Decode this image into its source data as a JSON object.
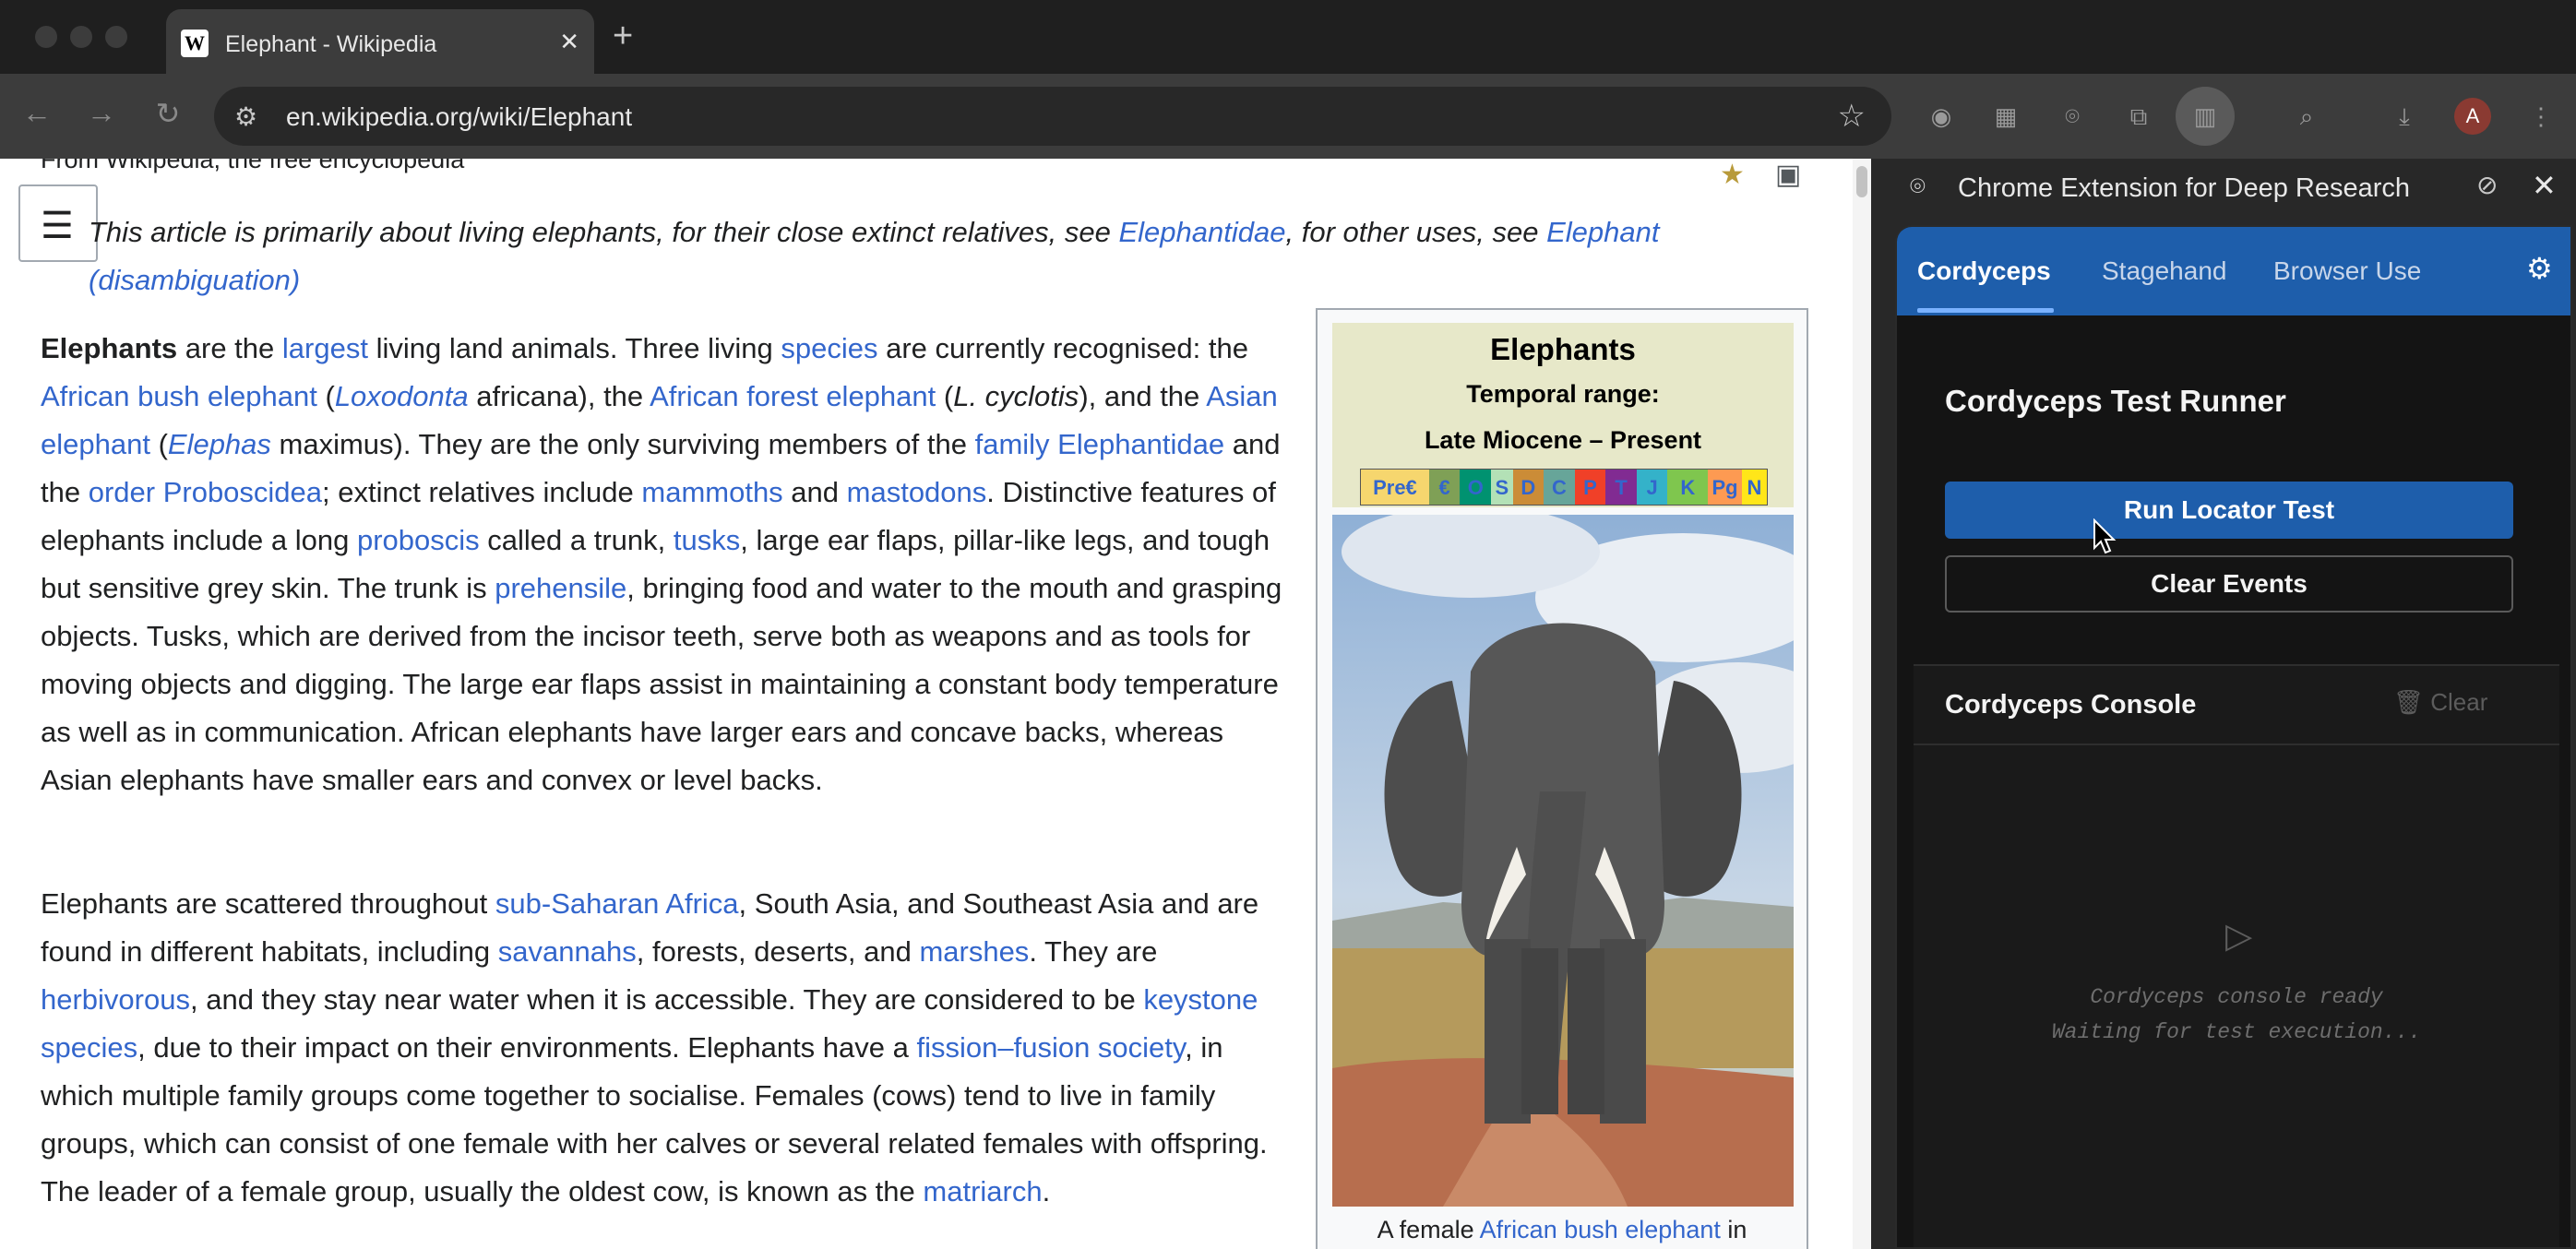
{
  "browser": {
    "tab": {
      "title": "Elephant - Wikipedia",
      "favicon": "W",
      "close": "✕"
    },
    "new_tab": "+",
    "url": "en.wikipedia.org/wiki/Elephant",
    "avatar_initial": "A",
    "nav_icons": [
      "back-icon",
      "forward-icon",
      "reload-icon"
    ]
  },
  "article": {
    "from_wiki": "From Wikipedia, the free encyclopedia",
    "hatnote": {
      "t1": "This article is primarily about living elephants, for their close extinct relatives, see ",
      "l1": "Elephantidae",
      "t2": ", for other uses, see ",
      "l2": "Elephant (disambiguation)"
    },
    "p1": {
      "s0": "Elephants",
      "s1": " are the ",
      "l_largest": "largest",
      "s2": " living land animals. Three living ",
      "l_species": "species",
      "s3": " are currently recognised: the ",
      "l_abe": "African bush elephant",
      "s4": " (",
      "i_loxodonta": "Loxodonta",
      "s5": " africana), the ",
      "l_afe": "African forest elephant",
      "s6": " (",
      "i_lc": "L. cyclotis",
      "s7": "), and the ",
      "l_asian": "Asian elephant",
      "s8": " (",
      "i_elephas": "Elephas",
      "s9": " maximus). They are the only surviving members of the ",
      "l_family": "family Elephantidae",
      "s10": " and the ",
      "l_order": "order Proboscidea",
      "s11": "; extinct relatives include ",
      "l_mammoths": "mammoths",
      "s12": " and ",
      "l_mastodons": "mastodons",
      "s13": ". Distinctive features of elephants include a long ",
      "l_proboscis": "proboscis",
      "s14": " called a trunk, ",
      "l_tusks": "tusks",
      "s15": ", large ear flaps, pillar-like legs, and tough but sensitive grey skin. The trunk is ",
      "l_prehensile": "prehensile",
      "s16": ", bringing food and water to the mouth and grasping objects. Tusks, which are derived from the incisor teeth, serve both as weapons and as tools for moving objects and digging. The large ear flaps assist in maintaining a constant body temperature as well as in communication. African elephants have larger ears and concave backs, whereas Asian elephants have smaller ears and convex or level backs."
    },
    "p2": {
      "s1": "Elephants are scattered throughout ",
      "l_ssa": "sub-Saharan Africa",
      "s2": ", South Asia, and Southeast Asia and are found in different habitats, including ",
      "l_savannahs": "savannahs",
      "s3": ", forests, deserts, and ",
      "l_marshes": "marshes",
      "s4": ". They are ",
      "l_herbivorous": "herbivorous",
      "s5": ", and they stay near water when it is accessible. They are considered to be ",
      "l_keystone": "keystone species",
      "s6": ", due to their impact on their environments. Elephants have a ",
      "l_fission": "fission–fusion society",
      "s7": ", in which multiple family groups come together to socialise. Females (cows) tend to live in family groups, which can consist of one female with her calves or several related females with offspring. The leader of a female group, usually the oldest cow, is known as the ",
      "l_matriarch": "matriarch",
      "s8": "."
    },
    "infobox": {
      "title": "Elephants",
      "range_label": "Temporal range:",
      "range_value": "Late Miocene – Present",
      "timeline": [
        "Pre€",
        "€",
        "O",
        "S",
        "D",
        "C",
        "P",
        "T",
        "J",
        "K",
        "Pg",
        "N"
      ],
      "timeline_colors": [
        "#f6d66e",
        "#7fa056",
        "#009270",
        "#b3e1b6",
        "#cb8c37",
        "#67a599",
        "#f04028",
        "#812b92",
        "#34b2c9",
        "#7fc64e",
        "#fd9a52",
        "#ffe619"
      ],
      "caption_text": "A female ",
      "caption_link": "African bush elephant",
      "caption_tail": " in"
    }
  },
  "side_panel": {
    "title": "Chrome Extension for Deep Research",
    "tabs": [
      {
        "label": "Cordyceps",
        "active": true
      },
      {
        "label": "Stagehand",
        "active": false
      },
      {
        "label": "Browser Use",
        "active": false
      }
    ],
    "runner_title": "Cordyceps Test Runner",
    "run_button": "Run Locator Test",
    "clear_events_button": "Clear Events",
    "console_title": "Cordyceps Console",
    "console_clear": "Clear",
    "console_ready": "Cordyceps console ready",
    "console_waiting": "Waiting for test execution...",
    "accent_color": "#1e5eab"
  }
}
